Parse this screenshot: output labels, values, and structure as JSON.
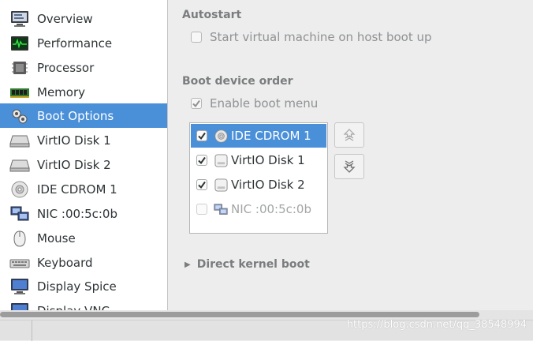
{
  "sidebar": {
    "items": [
      {
        "label": "Overview",
        "icon": "monitor-info-icon",
        "selected": false
      },
      {
        "label": "Performance",
        "icon": "performance-graph-icon",
        "selected": false
      },
      {
        "label": "Processor",
        "icon": "cpu-chip-icon",
        "selected": false
      },
      {
        "label": "Memory",
        "icon": "memory-module-icon",
        "selected": false
      },
      {
        "label": "Boot Options",
        "icon": "boot-gears-icon",
        "selected": true
      },
      {
        "label": "VirtIO Disk 1",
        "icon": "hard-disk-icon",
        "selected": false
      },
      {
        "label": "VirtIO Disk 2",
        "icon": "hard-disk-icon",
        "selected": false
      },
      {
        "label": "IDE CDROM 1",
        "icon": "cdrom-disc-icon",
        "selected": false
      },
      {
        "label": "NIC :00:5c:0b",
        "icon": "network-nic-icon",
        "selected": false
      },
      {
        "label": "Mouse",
        "icon": "mouse-icon",
        "selected": false
      },
      {
        "label": "Keyboard",
        "icon": "keyboard-icon",
        "selected": false
      },
      {
        "label": "Display Spice",
        "icon": "display-monitor-icon",
        "selected": false
      },
      {
        "label": "Display VNC",
        "icon": "display-monitor-icon",
        "selected": false
      }
    ]
  },
  "autostart": {
    "title": "Autostart",
    "checkbox_label": "Start virtual machine on host boot up",
    "checked": false
  },
  "boot_order": {
    "title": "Boot device order",
    "enable_menu_label": "Enable boot menu",
    "enable_menu_checked": true,
    "devices": [
      {
        "label": "IDE CDROM 1",
        "icon": "cdrom-disc-icon",
        "checked": true,
        "selected": true,
        "enabled": true
      },
      {
        "label": "VirtIO Disk 1",
        "icon": "hard-disk-icon",
        "checked": true,
        "selected": false,
        "enabled": true
      },
      {
        "label": "VirtIO Disk 2",
        "icon": "hard-disk-icon",
        "checked": true,
        "selected": false,
        "enabled": true
      },
      {
        "label": "NIC :00:5c:0b",
        "icon": "network-nic-icon",
        "checked": false,
        "selected": false,
        "enabled": false
      }
    ],
    "move_up_icon": "move-up-icon",
    "move_down_icon": "move-down-icon"
  },
  "direct_kernel": {
    "label": "Direct kernel boot",
    "expanded": false
  },
  "watermark": "https://blog.csdn.net/qq_38548994",
  "colors": {
    "selection": "#4a90d9",
    "pane_background": "#ededed",
    "section_title": "#7a7d7e"
  }
}
